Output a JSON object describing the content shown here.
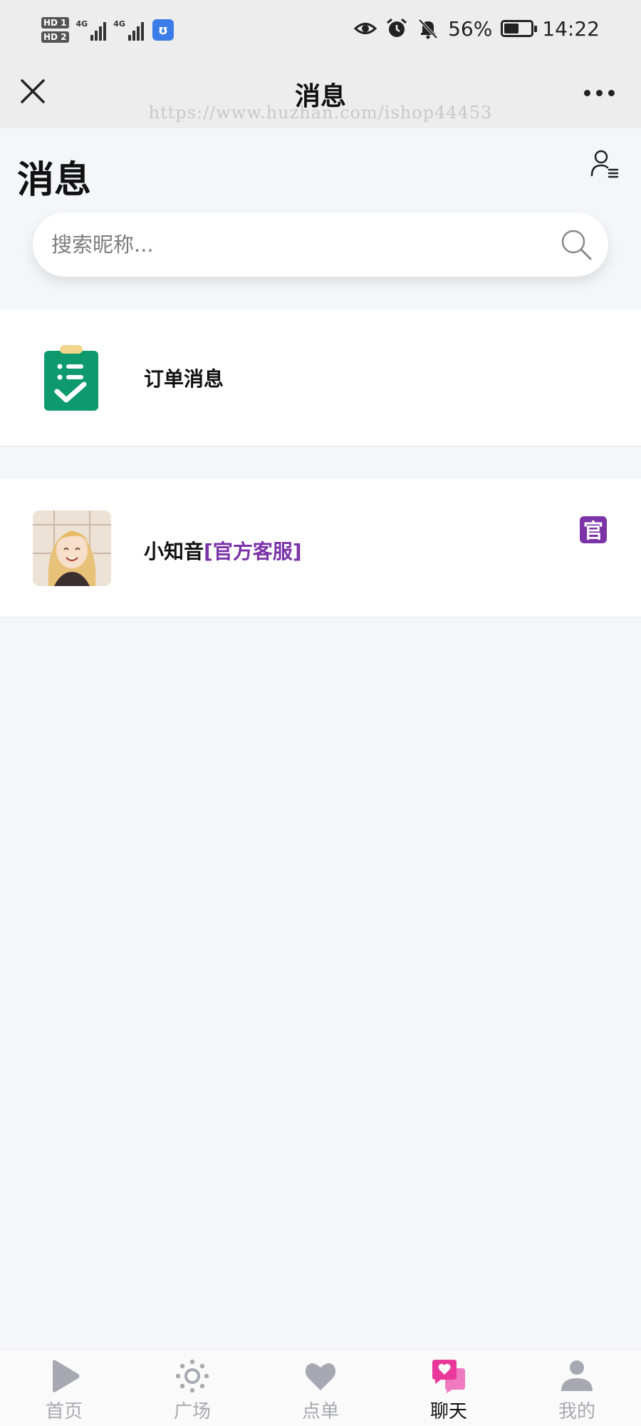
{
  "status_bar": {
    "hd1": "HD 1",
    "hd2": "HD 2",
    "net1": "4G",
    "net2": "4G",
    "app_badge": "ʊ",
    "battery_text": "56%",
    "battery_level": 0.56,
    "time": "14:22",
    "icons": [
      "eye-icon",
      "alarm-icon",
      "bell-off-icon",
      "battery-icon"
    ]
  },
  "nav": {
    "title": "消息",
    "watermark": "https://www.huzhan.com/ishop44453",
    "close_icon": "close-icon",
    "more_icon": "more-icon"
  },
  "header": {
    "title": "消息",
    "contacts_icon": "contacts-list-icon"
  },
  "search": {
    "placeholder": "搜索昵称...",
    "value": "",
    "icon": "search-icon"
  },
  "list": {
    "order": {
      "label": "订单消息",
      "icon": "clipboard-check-icon",
      "icon_color": "#0e9a6c"
    },
    "customer_service": {
      "name": "小知音",
      "tag": "[官方客服]",
      "badge": "官",
      "badge_color": "#7b33a8"
    }
  },
  "tabs": [
    {
      "label": "首页",
      "icon": "play-icon",
      "active": false
    },
    {
      "label": "广场",
      "icon": "sun-icon",
      "active": false
    },
    {
      "label": "点单",
      "icon": "heart-icon",
      "active": false
    },
    {
      "label": "聊天",
      "icon": "chat-heart-icon",
      "active": true
    },
    {
      "label": "我的",
      "icon": "user-icon",
      "active": false
    }
  ],
  "colors": {
    "accent_pink": "#e8399b",
    "tab_inactive": "#a8a8b2",
    "official_purple": "#7b33a8"
  }
}
